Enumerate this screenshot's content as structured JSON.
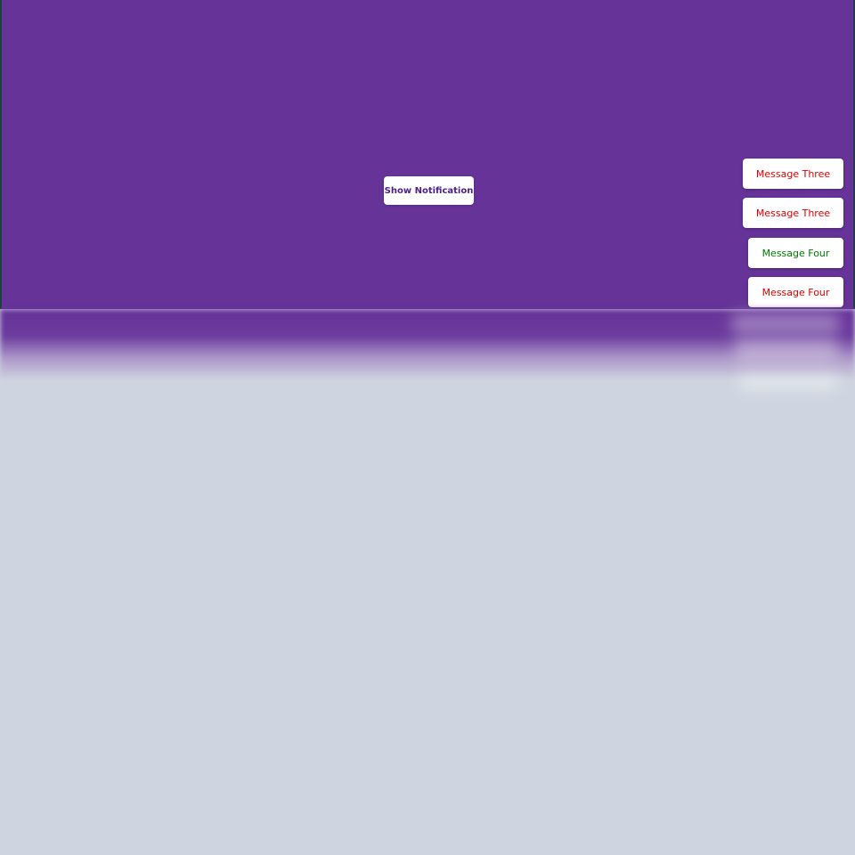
{
  "main": {
    "show_notification_label": "Show Notification"
  },
  "notifications": [
    {
      "message": "Message Three",
      "color": "#dd0000"
    },
    {
      "message": "Message Three",
      "color": "#dd0000"
    },
    {
      "message": "Message Four",
      "color": "#007700"
    },
    {
      "message": "Message Four",
      "color": "#dd0000"
    }
  ],
  "colors": {
    "stage_background": "#663399",
    "page_background": "#cfd5e0",
    "button_text": "#4b1f8a",
    "error": "#dd0000",
    "success": "#007700"
  }
}
